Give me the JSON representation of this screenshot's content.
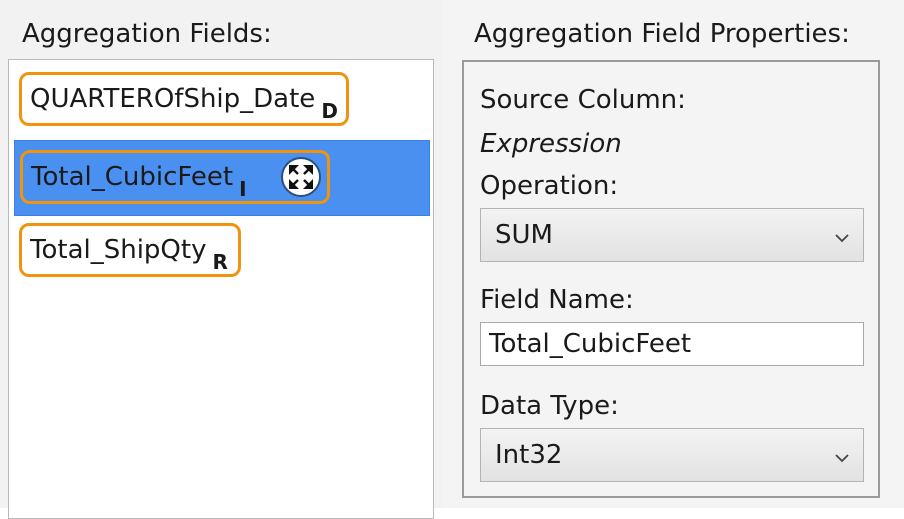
{
  "left_panel": {
    "title": "Aggregation Fields:",
    "items": [
      {
        "label": "QUARTEROfShip_Date",
        "suffix": "D",
        "selected": false
      },
      {
        "label": "Total_CubicFeet",
        "suffix": "I",
        "selected": true
      },
      {
        "label": "Total_ShipQty",
        "suffix": "R",
        "selected": false
      }
    ]
  },
  "right_panel": {
    "title": "Aggregation Field Properties:",
    "source_column_label": "Source Column:",
    "source_column_value": "Expression",
    "operation_label": "Operation:",
    "operation_value": "SUM",
    "field_name_label": "Field Name:",
    "field_name_value": "Total_CubicFeet",
    "data_type_label": "Data Type:",
    "data_type_value": "Int32"
  },
  "icons": {
    "move": "move-arrows-icon",
    "dropdown": "chevron-down-icon"
  },
  "colors": {
    "selection": "#4a90f0",
    "chip_border": "#f0930e"
  }
}
